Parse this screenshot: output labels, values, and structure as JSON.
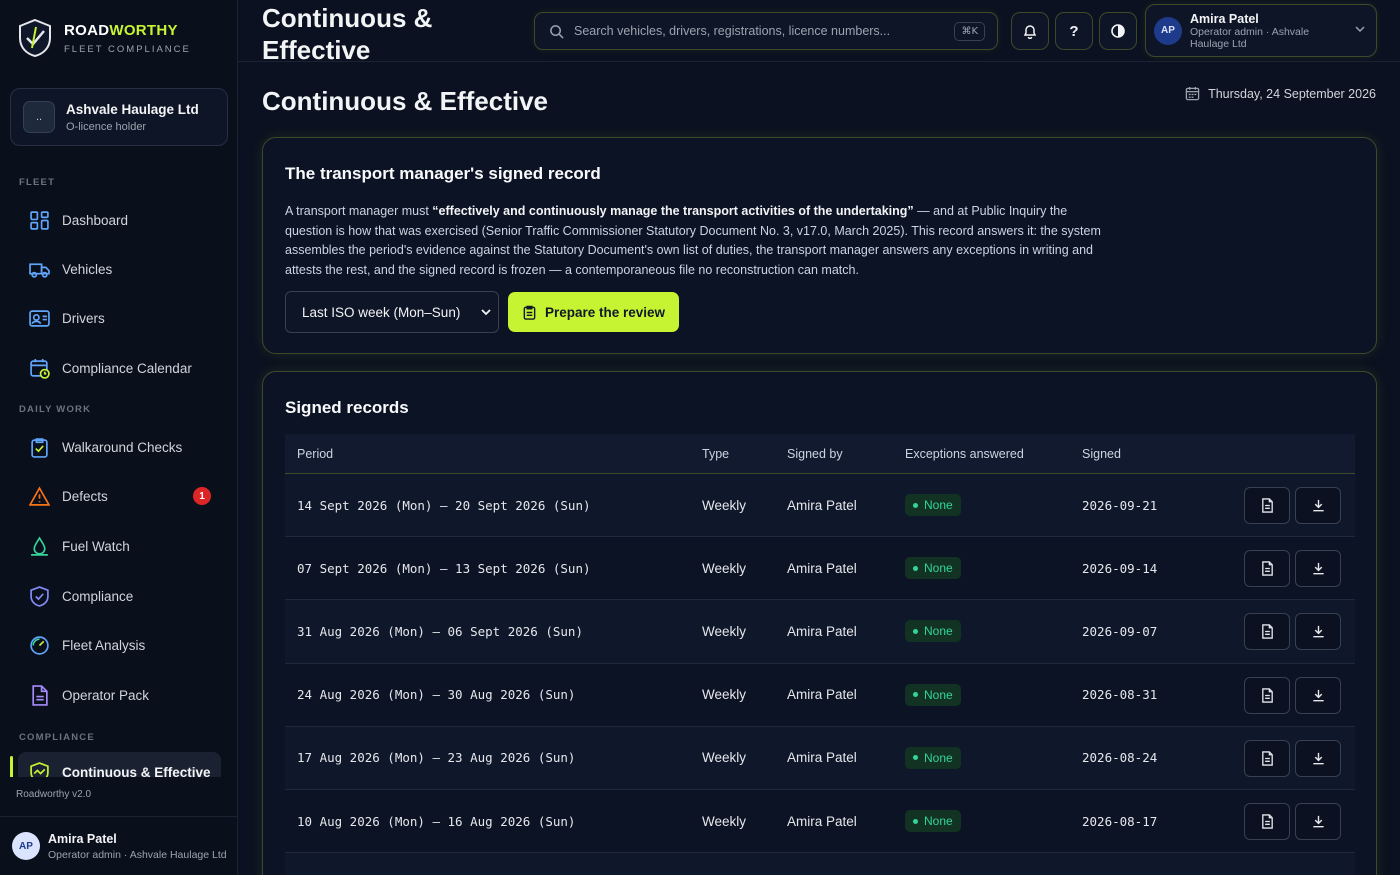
{
  "brand": {
    "name_main": "ROAD",
    "name_accent": "WORTHY",
    "subtitle": "FLEET COMPLIANCE"
  },
  "org": {
    "avatar_text": "..",
    "name": "Ashvale Haulage Ltd",
    "role": "O-licence holder"
  },
  "sidebar": {
    "sections": [
      "FLEET",
      "DAILY WORK",
      "COMPLIANCE"
    ],
    "items": [
      {
        "label": "Dashboard",
        "icon": "grid-icon"
      },
      {
        "label": "Vehicles",
        "icon": "truck-icon"
      },
      {
        "label": "Drivers",
        "icon": "id-card-icon"
      },
      {
        "label": "Compliance Calendar",
        "icon": "calendar-clock-icon"
      },
      {
        "label": "Walkaround Checks",
        "icon": "clipboard-check-icon"
      },
      {
        "label": "Defects",
        "icon": "warning-triangle-icon",
        "badge": "1"
      },
      {
        "label": "Fuel Watch",
        "icon": "fuel-drop-icon"
      },
      {
        "label": "Compliance",
        "icon": "shield-check-icon"
      },
      {
        "label": "Fleet Analysis",
        "icon": "gauge-icon"
      },
      {
        "label": "Operator Pack",
        "icon": "document-icon"
      },
      {
        "label": "Continuous & Effective",
        "icon": "shield-wave-icon",
        "active": true
      }
    ],
    "version": "Roadworthy v2.0"
  },
  "user": {
    "initials": "AP",
    "name": "Amira Patel",
    "role": "Operator admin · Ashvale Haulage Ltd"
  },
  "header": {
    "title": "Continuous & Effective",
    "search_placeholder": "Search vehicles, drivers, registrations, licence numbers...",
    "shortcut": "⌘K",
    "help_label": "?"
  },
  "page": {
    "title": "Continuous & Effective",
    "date": "Thursday, 24 September 2026"
  },
  "review_card": {
    "title": "The transport manager's signed record",
    "desc_before": "A transport manager must ",
    "desc_bold": "“effectively and continuously manage the transport activities of the undertaking”",
    "desc_after": " — and at Public Inquiry the question is how that was exercised (Senior Traffic Commissioner Statutory Document No. 3, v17.0, March 2025). This record answers it: the system assembles the period's evidence against the Statutory Document's own list of duties, the transport manager answers any exceptions in writing and attests the rest, and the signed record is frozen — a contemporaneous file no reconstruction can match.",
    "period_select": "Last ISO week (Mon–Sun)",
    "prepare_button": "Prepare the review"
  },
  "records": {
    "title": "Signed records",
    "columns": [
      "Period",
      "Type",
      "Signed by",
      "Exceptions answered",
      "Signed"
    ],
    "rows": [
      {
        "period": "14 Sept 2026 (Mon) – 20 Sept 2026 (Sun)",
        "type": "Weekly",
        "signed_by": "Amira Patel",
        "exceptions": "None",
        "signed": "2026-09-21"
      },
      {
        "period": "07 Sept 2026 (Mon) – 13 Sept 2026 (Sun)",
        "type": "Weekly",
        "signed_by": "Amira Patel",
        "exceptions": "None",
        "signed": "2026-09-14"
      },
      {
        "period": "31 Aug 2026 (Mon) – 06 Sept 2026 (Sun)",
        "type": "Weekly",
        "signed_by": "Amira Patel",
        "exceptions": "None",
        "signed": "2026-09-07"
      },
      {
        "period": "24 Aug 2026 (Mon) – 30 Aug 2026 (Sun)",
        "type": "Weekly",
        "signed_by": "Amira Patel",
        "exceptions": "None",
        "signed": "2026-08-31"
      },
      {
        "period": "17 Aug 2026 (Mon) – 23 Aug 2026 (Sun)",
        "type": "Weekly",
        "signed_by": "Amira Patel",
        "exceptions": "None",
        "signed": "2026-08-24"
      },
      {
        "period": "10 Aug 2026 (Mon) – 16 Aug 2026 (Sun)",
        "type": "Weekly",
        "signed_by": "Amira Patel",
        "exceptions": "None",
        "signed": "2026-08-17"
      }
    ]
  },
  "colors": {
    "accent": "#c6f432",
    "danger": "#dc2626",
    "success": "#34d399",
    "background": "#0b1120"
  }
}
